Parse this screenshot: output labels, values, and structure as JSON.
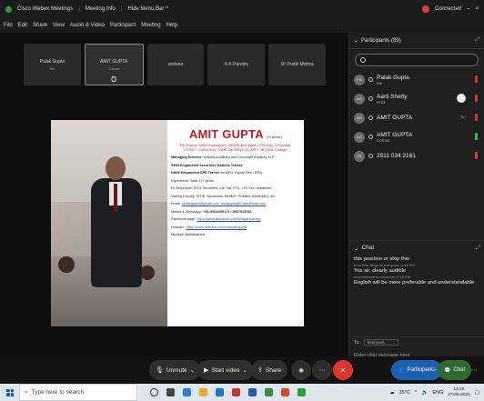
{
  "titlebar": {
    "app_title": "Cisco Webex Meetings",
    "meeting_info": "Meeting Info",
    "hide_menu": "Hide Menu Bar ^",
    "connected": "Connected",
    "minimize": "–",
    "close": "×"
  },
  "menubar": {
    "items": [
      "File",
      "Edit",
      "Share",
      "View",
      "Audio & Video",
      "Participant",
      "Meeting",
      "Help"
    ]
  },
  "thumbnails": [
    {
      "name": "Palak Gupta",
      "sub": "Me"
    },
    {
      "name": "AMIT GUPTA",
      "sub": "Cohost"
    },
    {
      "name": "anitana",
      "sub": ""
    },
    {
      "name": "K K Pandey",
      "sub": ""
    },
    {
      "name": "Dr Pratik Mishra",
      "sub": ""
    }
  ],
  "slide": {
    "name": "AMIT GUPTA",
    "name_suffix": "(Trainer)",
    "quals": "MS Finance, MMS Finance(NIT), MBA Project Mgmt, CFP(USA), CFA(India), CCRA™, CWM(USA), CIWM, Dip TAX(STD), AIR™, BE(Govt. College)",
    "lines": [
      {
        "b": "Managing Director: ",
        "t": "iCapital Academy and Corporate Advisory LLP"
      },
      {
        "b": "SEBI Empaneled Securities Markets Trainer.",
        "t": ""
      },
      {
        "b": "NISM Empaneled CPE Trainer",
        "t": " for MFD, Equity Deri., RRA"
      },
      {
        "b": "",
        "t": "Experience: Total 17+ years"
      },
      {
        "b": "",
        "t": "Ex-Employee: ICICI Securities, IGE Ltd, FTIL, UTI Sec.,Indiabulls"
      },
      {
        "b": "",
        "t": "Visiting Faculty: NITIE, Symbiosis, NMIMS, PUMBA, ADMI(MU), etc."
      }
    ],
    "email_label": "Email: ",
    "email_value": "amitsrgupta@gmail.com, amitgupta@iCapitalindia.com",
    "mobile_label": "Mobile & WhatsApp: ",
    "mobile_value": "+91-9004459173 / 9967913782",
    "facebook_label": "Facebook page: ",
    "facebook_value": "https://www.facebook.com/iVidyaLearning",
    "linkedin_label": "LinkedIn: ",
    "linkedin_value": "https://www.linkedin.com/in/amitsrgupta",
    "location": "Mumbai, Maharashtra"
  },
  "controls": {
    "unmute": "Unmute",
    "start_video": "Start video",
    "share": "Share",
    "participants": "Participants",
    "chat": "Chat"
  },
  "participants_panel": {
    "title": "Participants (89)",
    "search_placeholder": "",
    "people": [
      {
        "initials": "PG",
        "name": "Palak Gupta",
        "role": "Me",
        "mic": "red"
      },
      {
        "initials": "AS",
        "name": "Aarti Shetty",
        "role": "Host",
        "mic": "red"
      },
      {
        "initials": "AG",
        "name": "AMIT GUPTA",
        "role": "",
        "mic": "red"
      },
      {
        "initials": "AG",
        "name": "AMIT GUPTA",
        "role": "Cohost",
        "mic": "green"
      },
      {
        "initials": "25",
        "name": "2511 034 2161",
        "role": "",
        "mic": "red"
      }
    ]
  },
  "chat_panel": {
    "title": "Chat",
    "messages": [
      {
        "text": "this practice or stop this",
        "meta": "from Ritu Singh to everyone:   1:58 PM"
      },
      {
        "text": "Yes sir. clearly audible",
        "meta": "from Micheal to everyone:   2:16 PM"
      },
      {
        "text": "English will be more preferable and understandable",
        "meta": ""
      }
    ],
    "to_label": "To:",
    "to_value": "Everyone",
    "input_placeholder": "Enter chat message here"
  },
  "taskbar": {
    "search_placeholder": "Type here to search",
    "weather": "35°C",
    "lang": "ENG",
    "time": "14:26",
    "date": "27-05-2021"
  }
}
